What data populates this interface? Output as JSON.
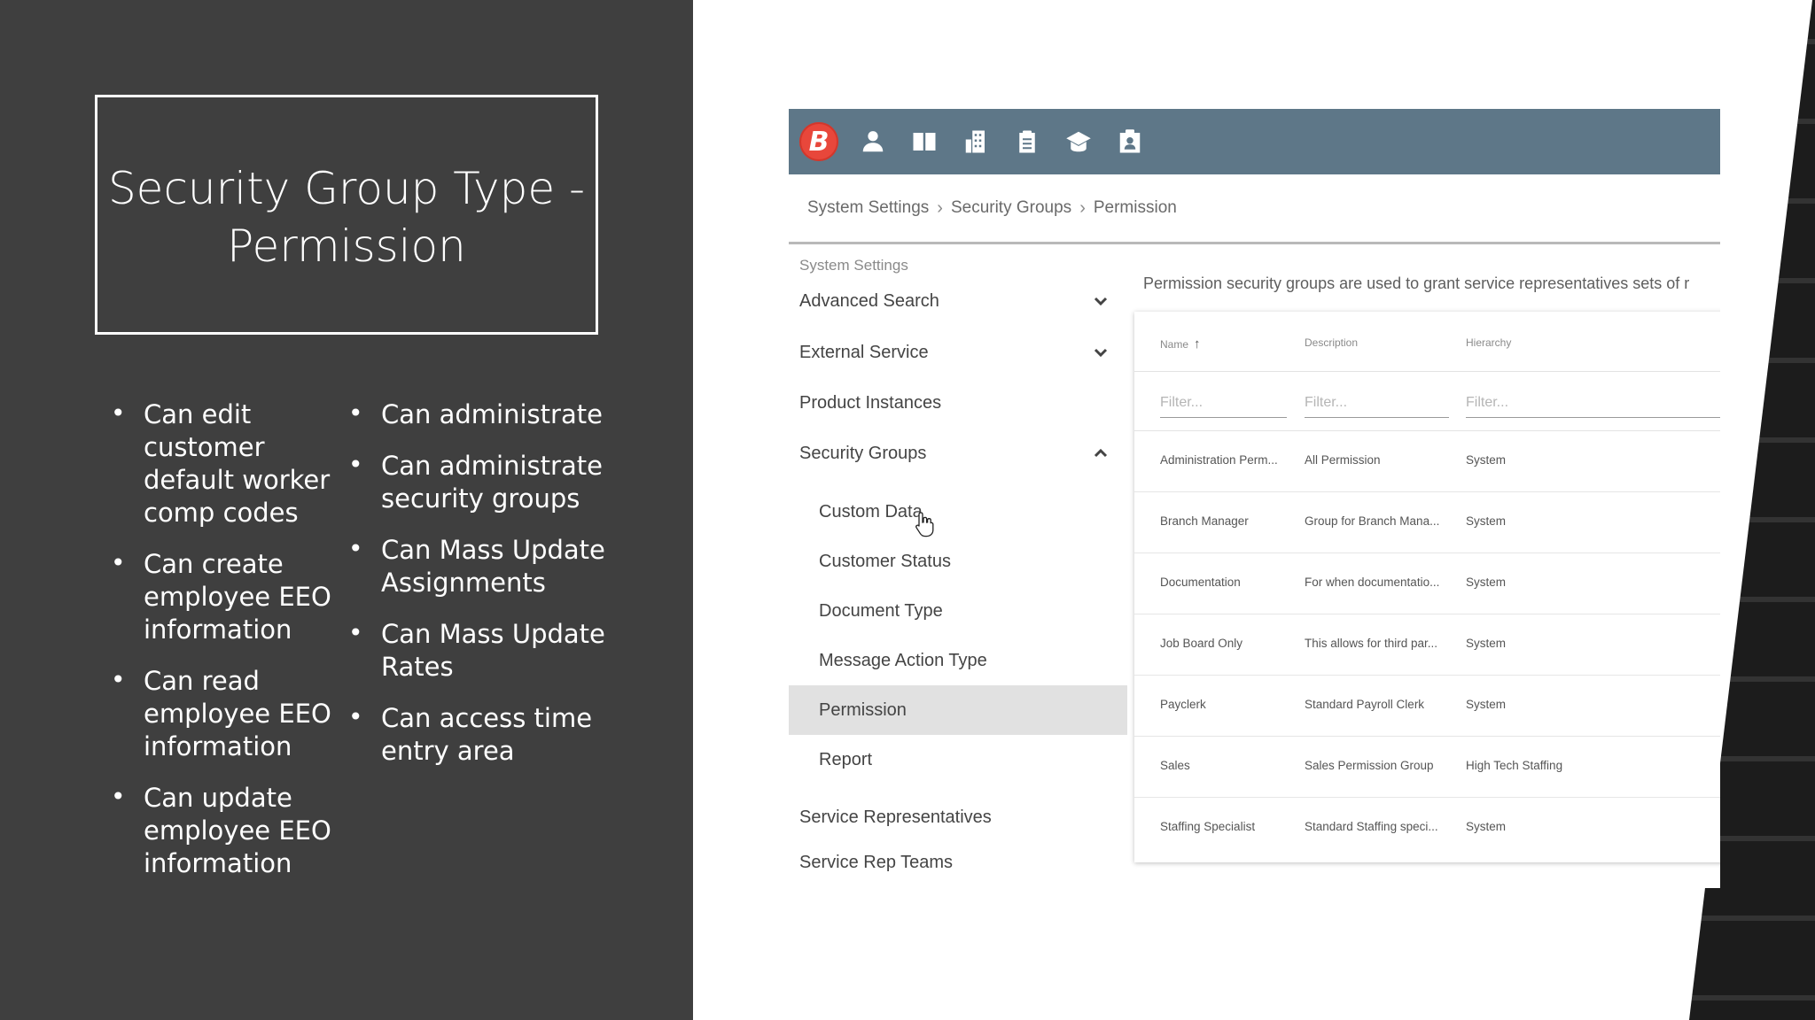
{
  "slide": {
    "title": "Security Group Type - Permission",
    "bullets_col1": [
      "Can edit customer default worker comp codes",
      "Can create employee EEO information",
      "Can read employee EEO information",
      "Can update employee EEO information"
    ],
    "bullets_col2": [
      "Can administrate",
      "Can administrate security groups",
      "Can Mass Update Assignments",
      "Can Mass Update Rates",
      "Can access time entry area"
    ]
  },
  "app": {
    "logo_letter": "B",
    "nav_icons": [
      "person-icon",
      "book-icon",
      "building-icon",
      "clipboard-icon",
      "cap-icon",
      "badge-icon"
    ],
    "breadcrumb": [
      "System Settings",
      "Security Groups",
      "Permission"
    ],
    "sidebar": {
      "heading": "System Settings",
      "items": [
        {
          "label": "Advanced Search",
          "chevron": "down"
        },
        {
          "label": "External Service",
          "chevron": "down"
        },
        {
          "label": "Product Instances",
          "chevron": ""
        },
        {
          "label": "Security Groups",
          "chevron": "up"
        }
      ],
      "sub_items": [
        "Custom Data",
        "Customer Status",
        "Document Type",
        "Message Action Type",
        "Permission",
        "Report"
      ],
      "active_sub_item": "Permission",
      "after_items": [
        "Service Representatives",
        "Service Rep Teams"
      ]
    },
    "intro_text": "Permission security groups are used to grant service representatives sets of r",
    "table": {
      "columns": [
        "Name",
        "Description",
        "Hierarchy"
      ],
      "sort_column": "Name",
      "sort_direction": "ascending",
      "filter_placeholder": "Filter...",
      "rows": [
        [
          "Administration Perm...",
          "All Permission",
          "System"
        ],
        [
          "Branch Manager",
          "Group for Branch Mana...",
          "System"
        ],
        [
          "Documentation",
          "For when documentatio...",
          "System"
        ],
        [
          "Job Board Only",
          "This allows for third par...",
          "System"
        ],
        [
          "Payclerk",
          "Standard Payroll Clerk",
          "System"
        ],
        [
          "Sales",
          "Sales Permission Group",
          "High Tech Staffing"
        ],
        [
          "Staffing Specialist",
          "Standard Staffing speci...",
          "System"
        ]
      ]
    }
  },
  "colors": {
    "slide_bg": "#3f3f3f",
    "topbar": "#5e7788",
    "logo": "#e8473b",
    "active_item": "#e1e1e1"
  }
}
